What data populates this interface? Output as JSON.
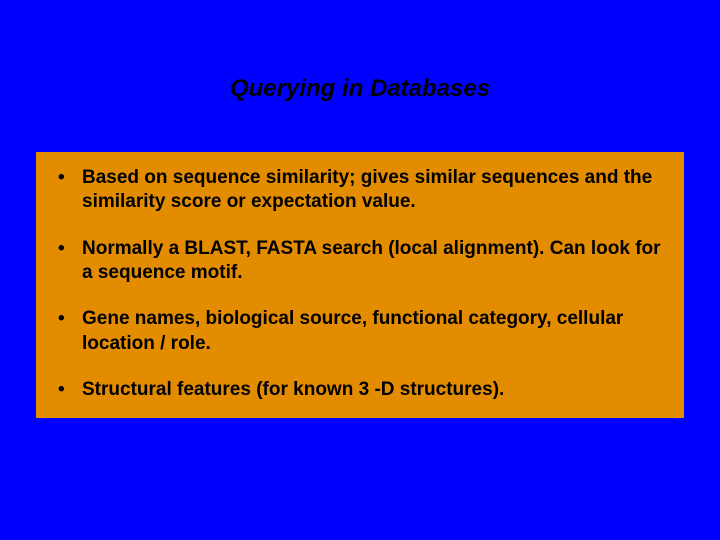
{
  "slide": {
    "title": "Querying in Databases",
    "bullets": [
      "Based on sequence similarity; gives similar sequences and the similarity score or expectation value.",
      "Normally a BLAST, FASTA search (local alignment). Can look for a sequence motif.",
      "Gene names, biological source, functional category, cellular location / role.",
      "Structural features (for known 3 -D structures)."
    ]
  }
}
